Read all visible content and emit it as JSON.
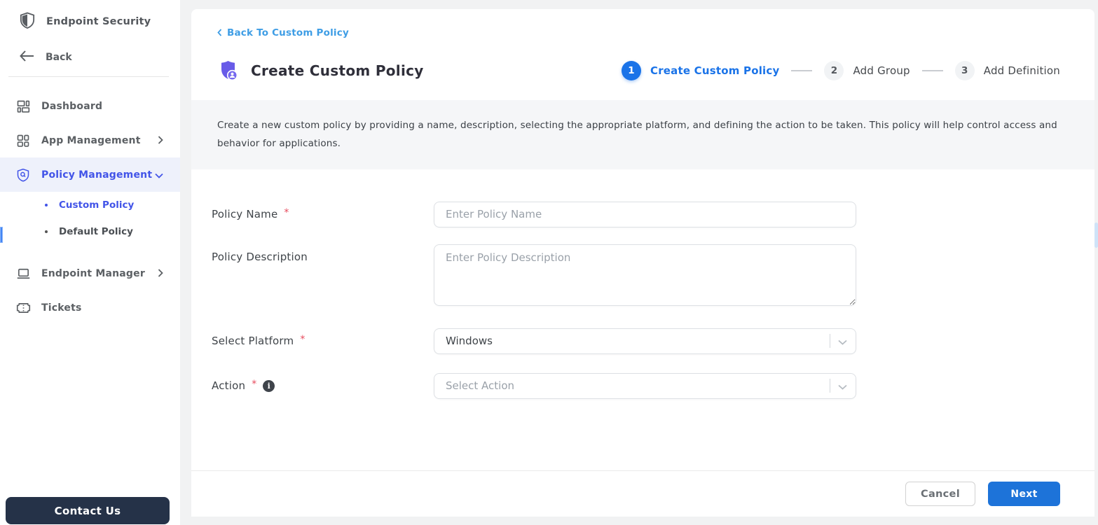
{
  "sidebar": {
    "brand_label": "Endpoint Security",
    "back_label": "Back",
    "dashboard_label": "Dashboard",
    "app_management_label": "App Management",
    "policy_management_label": "Policy Management",
    "custom_policy_label": "Custom Policy",
    "default_policy_label": "Default Policy",
    "endpoint_manager_label": "Endpoint Manager",
    "tickets_label": "Tickets",
    "contact_label": "Contact Us"
  },
  "header": {
    "back_link_label": "Back To Custom Policy",
    "title": "Create Custom Policy"
  },
  "stepper": {
    "steps": [
      {
        "number": "1",
        "label": "Create Custom Policy",
        "active": true
      },
      {
        "number": "2",
        "label": "Add Group",
        "active": false
      },
      {
        "number": "3",
        "label": "Add Definition",
        "active": false
      }
    ]
  },
  "intro": {
    "text": "Create a new custom policy by providing a name, description, selecting the appropriate platform, and defining the action to be taken. This policy will help control access and behavior for applications."
  },
  "form": {
    "required_marker": "*",
    "policy_name_label": "Policy Name",
    "policy_name_placeholder": "Enter Policy Name",
    "policy_name_value": "",
    "policy_description_label": "Policy Description",
    "policy_description_placeholder": "Enter Policy Description",
    "policy_description_value": "",
    "platform_label": "Select Platform",
    "platform_value": "Windows",
    "action_label": "Action",
    "action_placeholder": "Select Action",
    "info_icon_glyph": "i"
  },
  "footer": {
    "cancel_label": "Cancel",
    "next_label": "Next"
  },
  "colors": {
    "accent_blue": "#1a73e8",
    "sidebar_active_blue": "#4254e8",
    "link_blue": "#3e9de5",
    "title_icon_purple": "#685be8",
    "contact_bg": "#253248",
    "required_red": "#e74c5e",
    "step_inactive_bg": "#f1f3f5",
    "intro_band_bg": "#f5f6f8",
    "next_button_bg": "#1d73d9"
  }
}
